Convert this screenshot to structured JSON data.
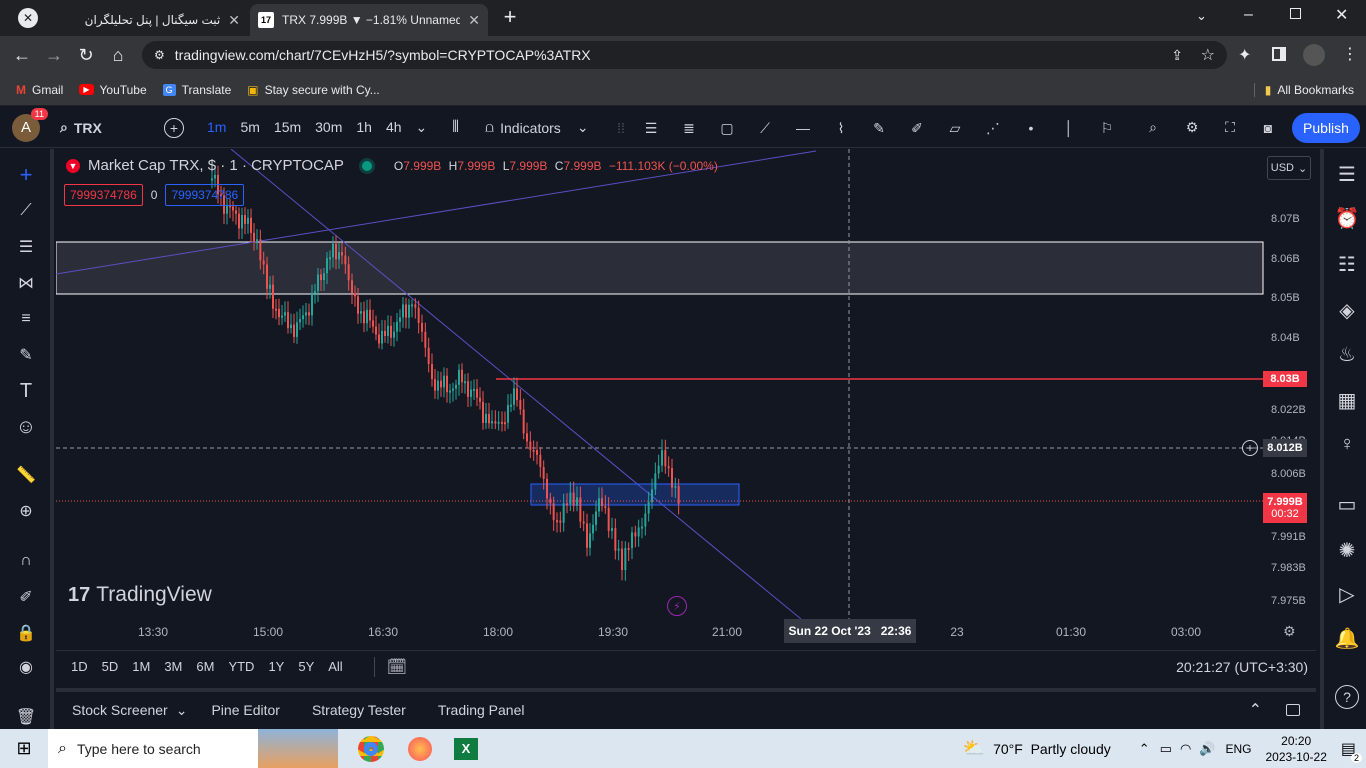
{
  "browser": {
    "tabs": [
      {
        "title": "ثبت سیگنال | پنل تحلیلگران",
        "active": false
      },
      {
        "title": "TRX 7.999B ▼ −1.81% Unnamed",
        "active": true
      }
    ],
    "new_tab": "+",
    "url": "tradingview.com/chart/7CEvHzH5/?symbol=CRYPTOCAP%3ATRX",
    "bookmarks": [
      "Gmail",
      "YouTube",
      "Translate",
      "Stay secure with Cy..."
    ],
    "all_bookmarks": "All Bookmarks"
  },
  "topbar": {
    "avatar_letter": "A",
    "notif_count": "11",
    "symbol": "TRX",
    "timeframes": [
      "1m",
      "5m",
      "15m",
      "30m",
      "1h",
      "4h"
    ],
    "active_timeframe": "1m",
    "indicators": "Indicators",
    "publish": "Publish"
  },
  "legend": {
    "title": "Market Cap TRX, $ · 1 · CRYPTOCAP",
    "o_label": "O",
    "o": "7.999B",
    "h_label": "H",
    "h": "7.999B",
    "l_label": "L",
    "l": "7.999B",
    "c_label": "C",
    "c": "7.999B",
    "change": "−111.103K (−0.00%)",
    "sell": "7999374786",
    "spread": "0",
    "buy": "7999374786"
  },
  "chart": {
    "currency": "USD",
    "price_labels": [
      "8.07B",
      "8.06B",
      "8.05B",
      "8.04B",
      "8.022B",
      "8.006B",
      "7.991B",
      "7.983B",
      "7.975B"
    ],
    "price_labels_extra": [
      "8.014B"
    ],
    "hline_label": "8.03B",
    "crosshair_label": "8.012B",
    "last_price": "7.999B",
    "countdown": "00:32",
    "time_labels": [
      "13:30",
      "15:00",
      "16:30",
      "18:00",
      "19:30",
      "21:00",
      "23",
      "01:30",
      "03:00"
    ],
    "crosshair_time": "Sun 22 Oct '23   22:36",
    "watermark": "TradingView",
    "colors": {
      "up": "#26a69a",
      "down": "#ef5350",
      "accent": "#2962ff",
      "hline": "#f23645"
    }
  },
  "range_bar": {
    "ranges": [
      "1D",
      "5D",
      "1M",
      "3M",
      "6M",
      "YTD",
      "1Y",
      "5Y",
      "All"
    ],
    "clock": "20:21:27 (UTC+3:30)"
  },
  "bottom_panel": {
    "tabs": [
      "Stock Screener",
      "Pine Editor",
      "Strategy Tester",
      "Trading Panel"
    ]
  },
  "taskbar": {
    "search_placeholder": "Type here to search",
    "weather": "70°F  Partly cloudy",
    "lang": "ENG",
    "time": "20:20",
    "date": "2023-10-22",
    "notifications": "2"
  }
}
